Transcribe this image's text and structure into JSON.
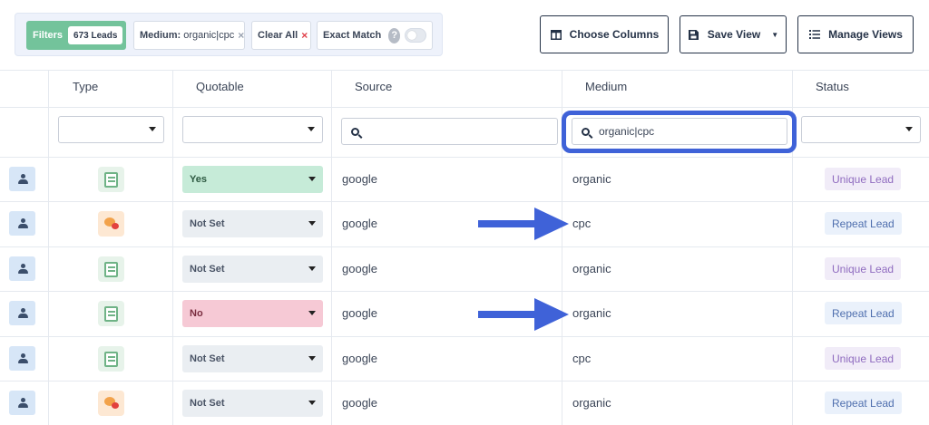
{
  "toolbar": {
    "filters_label": "Filters",
    "leads_count": "673 Leads",
    "medium_chip_key": "Medium:",
    "medium_chip_value": "organic|cpc",
    "medium_chip_remove": "×",
    "clear_all": "Clear All",
    "clear_all_x": "×",
    "exact_match": "Exact Match",
    "help": "?",
    "exact_match_on": false,
    "choose_columns": "Choose Columns",
    "save_view": "Save View",
    "manage_views": "Manage Views"
  },
  "table": {
    "headers": {
      "type": "Type",
      "quotable": "Quotable",
      "source": "Source",
      "medium": "Medium",
      "status": "Status"
    },
    "filters": {
      "medium_search_value": "organic|cpc",
      "source_search_value": ""
    },
    "rows": [
      {
        "type": "form-icon",
        "quotable": "Yes",
        "source": "google",
        "medium": "organic",
        "status": "Unique Lead"
      },
      {
        "type": "chat-icon",
        "quotable": "Not Set",
        "source": "google",
        "medium": "cpc",
        "status": "Repeat Lead"
      },
      {
        "type": "form-icon",
        "quotable": "Not Set",
        "source": "google",
        "medium": "organic",
        "status": "Unique Lead"
      },
      {
        "type": "form-icon",
        "quotable": "No",
        "source": "google",
        "medium": "organic",
        "status": "Repeat Lead"
      },
      {
        "type": "form-icon",
        "quotable": "Not Set",
        "source": "google",
        "medium": "cpc",
        "status": "Unique Lead"
      },
      {
        "type": "chat-icon",
        "quotable": "Not Set",
        "source": "google",
        "medium": "organic",
        "status": "Repeat Lead"
      }
    ]
  },
  "colors": {
    "highlight": "#3f62d8",
    "filters_green": "#73c39b",
    "annotation_arrow": "#3f62d8"
  }
}
